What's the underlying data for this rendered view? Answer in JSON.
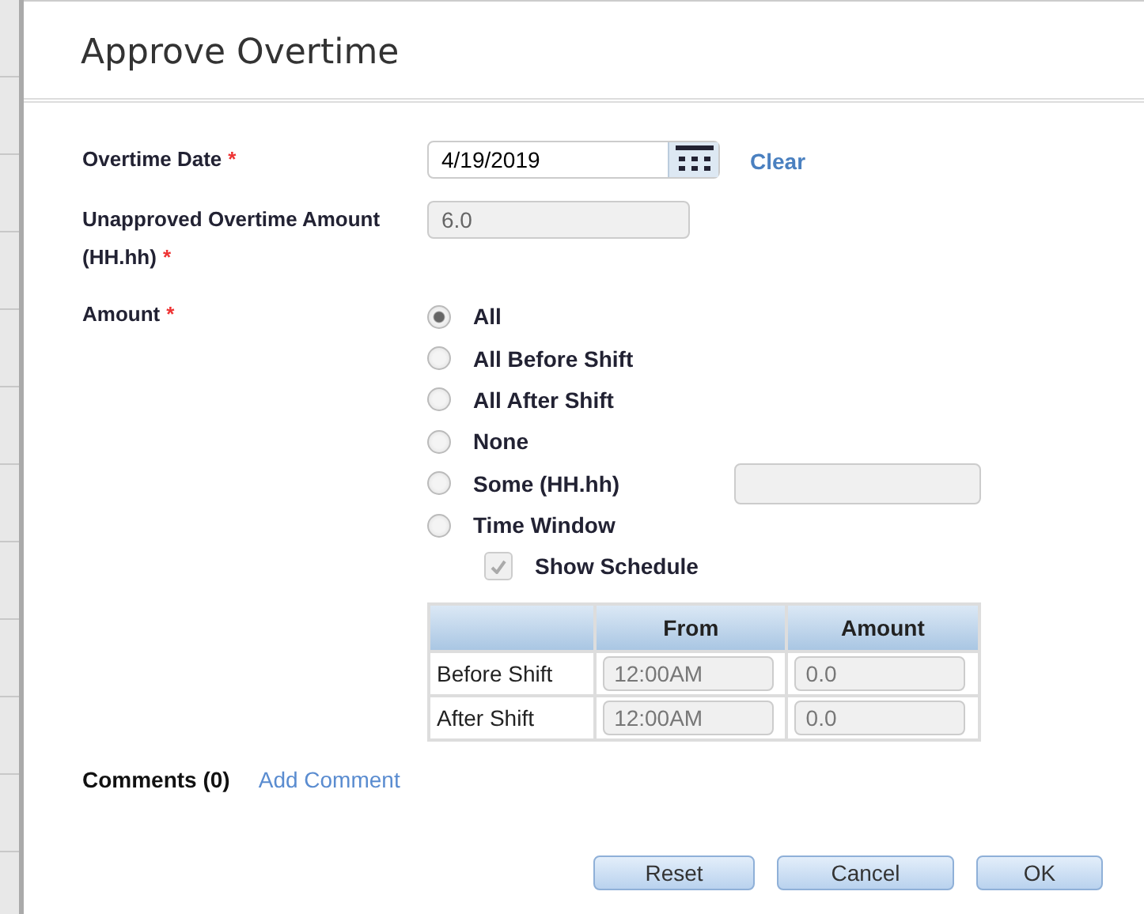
{
  "dialog": {
    "title": "Approve Overtime"
  },
  "overtime_date": {
    "label": "Overtime Date",
    "required_mark": "*",
    "value": "4/19/2019",
    "clear_link": "Clear"
  },
  "unapproved": {
    "label": "Unapproved Overtime Amount (HH.hh)",
    "required_mark": "*",
    "value": "6.0"
  },
  "amount": {
    "label": "Amount",
    "required_mark": "*",
    "options": [
      {
        "label": "All",
        "selected": true
      },
      {
        "label": "All Before Shift",
        "selected": false
      },
      {
        "label": "All After Shift",
        "selected": false
      },
      {
        "label": "None",
        "selected": false
      },
      {
        "label": "Some (HH.hh)",
        "selected": false,
        "kind": "with_field"
      },
      {
        "label": "Time Window",
        "selected": false
      }
    ],
    "show_schedule": {
      "label": "Show Schedule",
      "checked": true
    }
  },
  "table": {
    "columns": [
      "From",
      "Amount"
    ],
    "rows": [
      {
        "label": "Before Shift",
        "from": "12:00AM",
        "amount": "0.0"
      },
      {
        "label": "After Shift",
        "from": "12:00AM",
        "amount": "0.0"
      }
    ]
  },
  "comments": {
    "label": "Comments (0)",
    "link": "Add Comment"
  },
  "buttons": [
    "Reset",
    "Cancel",
    "OK"
  ]
}
